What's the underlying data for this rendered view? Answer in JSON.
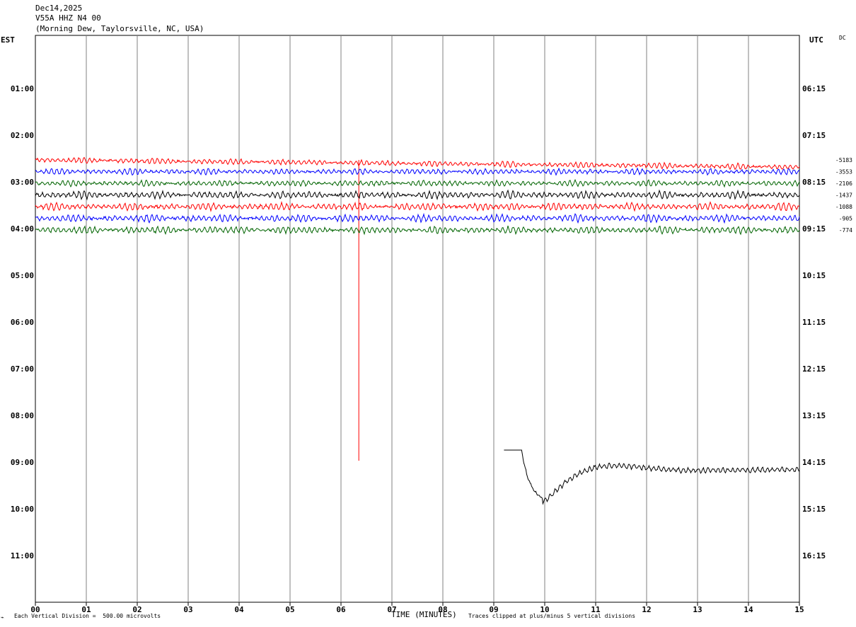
{
  "header": {
    "date": "Dec14,2025",
    "station": "V55A HHZ N4 00",
    "location": "(Morning Dew, Taylorsville, NC, USA)"
  },
  "left_axis_title": "EST",
  "right_axis_title": "UTC",
  "dc_label": "DC",
  "footer": {
    "vertical_division": "Each Vertical Division =  500.00 microvolts",
    "x_axis_title": "TIME (MINUTES)",
    "clip_note": "Traces clipped at plus/minus 5 vertical divisions"
  },
  "colors": {
    "red": "#ff0000",
    "blue": "#0000ff",
    "green": "#006400",
    "black": "#000000",
    "grid": "#808080"
  },
  "chart_data": {
    "type": "line",
    "title": "V55A HHZ N4 00",
    "x_axis": {
      "label": "TIME (MINUTES)",
      "range": [
        0,
        15
      ],
      "ticks": [
        "00",
        "01",
        "02",
        "03",
        "04",
        "05",
        "06",
        "07",
        "08",
        "09",
        "10",
        "11",
        "12",
        "13",
        "14",
        "15"
      ]
    },
    "rows_est": [
      "01:00",
      "02:00",
      "03:00",
      "04:00",
      "05:00",
      "06:00",
      "07:00",
      "08:00",
      "09:00",
      "10:00",
      "11:00"
    ],
    "rows_utc": [
      "06:15",
      "07:15",
      "08:15",
      "09:15",
      "10:15",
      "11:15",
      "12:15",
      "13:15",
      "14:15",
      "15:15",
      "16:15"
    ],
    "traces": [
      {
        "row": 9,
        "start_min": 9.2,
        "color": "black",
        "dc_offset": null,
        "note": "partial trace with step transient"
      },
      {
        "row": 10,
        "start_min": 0,
        "color": "red",
        "dc_offset": "-5183",
        "spike_at_min": 6.35
      },
      {
        "row": 11,
        "start_min": 0,
        "color": "blue",
        "dc_offset": "-3553"
      },
      {
        "row": 12,
        "start_min": 0,
        "color": "green",
        "dc_offset": "-2106"
      },
      {
        "row": 13,
        "start_min": 0,
        "color": "black",
        "dc_offset": "-1437"
      },
      {
        "row": 14,
        "start_min": 0,
        "color": "red",
        "dc_offset": "-1088"
      },
      {
        "row": 15,
        "start_min": 0,
        "color": "blue",
        "dc_offset": "-905"
      },
      {
        "row": 16,
        "start_min": 0,
        "color": "green",
        "dc_offset": "-774"
      }
    ],
    "vertical_division_microvolts": 500.0,
    "grid": true
  }
}
